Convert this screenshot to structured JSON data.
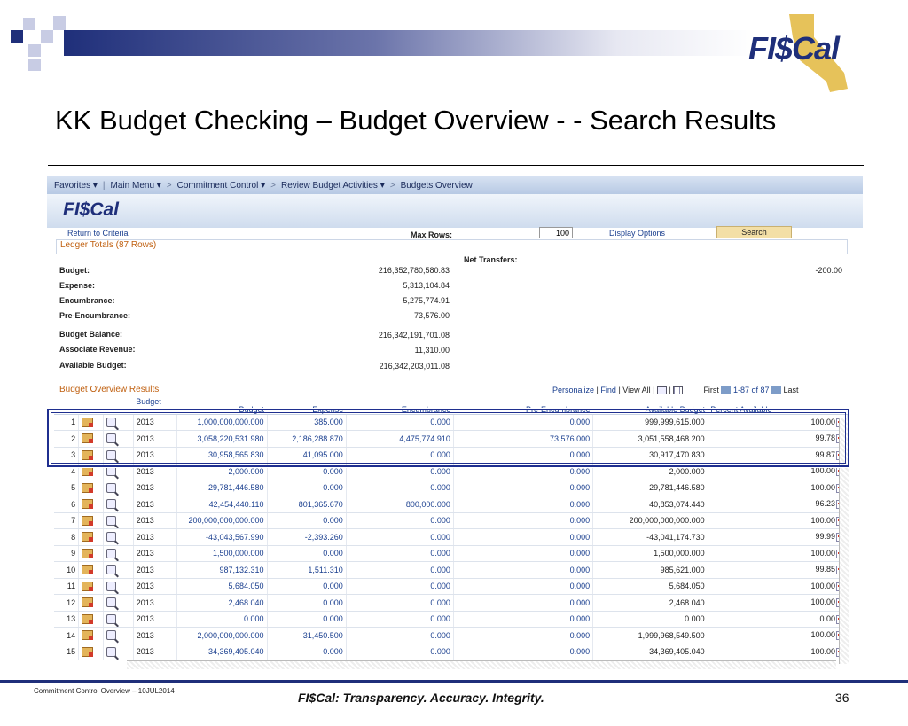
{
  "slide": {
    "title": "KK Budget Checking – Budget Overview - - Search Results",
    "logo_text": "FI$Cal",
    "footer_left": "Commitment Control Overview – 10JUL2014",
    "footer_tagline": "FI$Cal:  Transparency.  Accuracy.  Integrity.",
    "page_number": "36"
  },
  "nav": {
    "favorites": "Favorites ▾",
    "main_menu": "Main Menu ▾",
    "sep": ">",
    "crumbs": [
      "Commitment Control ▾",
      "Review Budget Activities ▾",
      "Budgets Overview"
    ]
  },
  "app": {
    "logo_text": "FI$Cal",
    "return_link": "Return to Criteria",
    "max_rows_label": "Max Rows:",
    "max_rows_value": "100",
    "display_options": "Display Options",
    "search_button": "Search"
  },
  "ledger": {
    "header": "Ledger Totals (87 Rows)",
    "net_transfers_label": "Net Transfers:",
    "net_transfers_value": "-200.00",
    "items": [
      {
        "label": "Budget:",
        "value": "216,352,780,580.83"
      },
      {
        "label": "Expense:",
        "value": "5,313,104.84"
      },
      {
        "label": "Encumbrance:",
        "value": "5,275,774.91"
      },
      {
        "label": "Pre-Encumbrance:",
        "value": "73,576.00"
      },
      {
        "label": "Budget Balance:",
        "value": "216,342,191,701.08"
      },
      {
        "label": "Associate Revenue:",
        "value": "11,310.00"
      },
      {
        "label": "Available Budget:",
        "value": "216,342,203,011.08"
      }
    ]
  },
  "results": {
    "header": "Budget Overview Results",
    "toolbar": {
      "personalize": "Personalize",
      "find": "Find",
      "view_all": "View All",
      "first": "First",
      "range": "1-87 of 87",
      "last": "Last",
      "bar": "|"
    },
    "columns": [
      "",
      "",
      "",
      "Budget",
      "Budget",
      "Expense",
      "Encumbrance",
      "Pre-Encumbrance",
      "Available Budget",
      "Percent Available"
    ],
    "rows": [
      {
        "n": "1",
        "year": "2013",
        "budget": "1,000,000,000.000",
        "expense": "385.000",
        "enc": "0.000",
        "pre": "0.000",
        "avail": "999,999,615.000",
        "pct": "100.00"
      },
      {
        "n": "2",
        "year": "2013",
        "budget": "3,058,220,531.980",
        "expense": "2,186,288.870",
        "enc": "4,475,774.910",
        "pre": "73,576.000",
        "avail": "3,051,558,468.200",
        "pct": "99.78"
      },
      {
        "n": "3",
        "year": "2013",
        "budget": "30,958,565.830",
        "expense": "41,095.000",
        "enc": "0.000",
        "pre": "0.000",
        "avail": "30,917,470.830",
        "pct": "99.87"
      },
      {
        "n": "4",
        "year": "2013",
        "budget": "2,000.000",
        "expense": "0.000",
        "enc": "0.000",
        "pre": "0.000",
        "avail": "2,000.000",
        "pct": "100.00"
      },
      {
        "n": "5",
        "year": "2013",
        "budget": "29,781,446.580",
        "expense": "0.000",
        "enc": "0.000",
        "pre": "0.000",
        "avail": "29,781,446.580",
        "pct": "100.00"
      },
      {
        "n": "6",
        "year": "2013",
        "budget": "42,454,440.110",
        "expense": "801,365.670",
        "enc": "800,000.000",
        "pre": "0.000",
        "avail": "40,853,074.440",
        "pct": "96.23"
      },
      {
        "n": "7",
        "year": "2013",
        "budget": "200,000,000,000.000",
        "expense": "0.000",
        "enc": "0.000",
        "pre": "0.000",
        "avail": "200,000,000,000.000",
        "pct": "100.00"
      },
      {
        "n": "8",
        "year": "2013",
        "budget": "-43,043,567.990",
        "expense": "-2,393.260",
        "enc": "0.000",
        "pre": "0.000",
        "avail": "-43,041,174.730",
        "pct": "99.99"
      },
      {
        "n": "9",
        "year": "2013",
        "budget": "1,500,000.000",
        "expense": "0.000",
        "enc": "0.000",
        "pre": "0.000",
        "avail": "1,500,000.000",
        "pct": "100.00"
      },
      {
        "n": "10",
        "year": "2013",
        "budget": "987,132.310",
        "expense": "1,511.310",
        "enc": "0.000",
        "pre": "0.000",
        "avail": "985,621.000",
        "pct": "99.85"
      },
      {
        "n": "11",
        "year": "2013",
        "budget": "5,684.050",
        "expense": "0.000",
        "enc": "0.000",
        "pre": "0.000",
        "avail": "5,684.050",
        "pct": "100.00"
      },
      {
        "n": "12",
        "year": "2013",
        "budget": "2,468.040",
        "expense": "0.000",
        "enc": "0.000",
        "pre": "0.000",
        "avail": "2,468.040",
        "pct": "100.00"
      },
      {
        "n": "13",
        "year": "2013",
        "budget": "0.000",
        "expense": "0.000",
        "enc": "0.000",
        "pre": "0.000",
        "avail": "0.000",
        "pct": "0.00"
      },
      {
        "n": "14",
        "year": "2013",
        "budget": "2,000,000,000.000",
        "expense": "31,450.500",
        "enc": "0.000",
        "pre": "0.000",
        "avail": "1,999,968,549.500",
        "pct": "100.00"
      },
      {
        "n": "15",
        "year": "2013",
        "budget": "34,369,405.040",
        "expense": "0.000",
        "enc": "0.000",
        "pre": "0.000",
        "avail": "34,369,405.040",
        "pct": "100.00"
      }
    ]
  },
  "colors": {
    "navy": "#1f2f7a",
    "link": "#1a3f8f",
    "group_header": "#c06010",
    "highlight": "#1f2f8f"
  }
}
